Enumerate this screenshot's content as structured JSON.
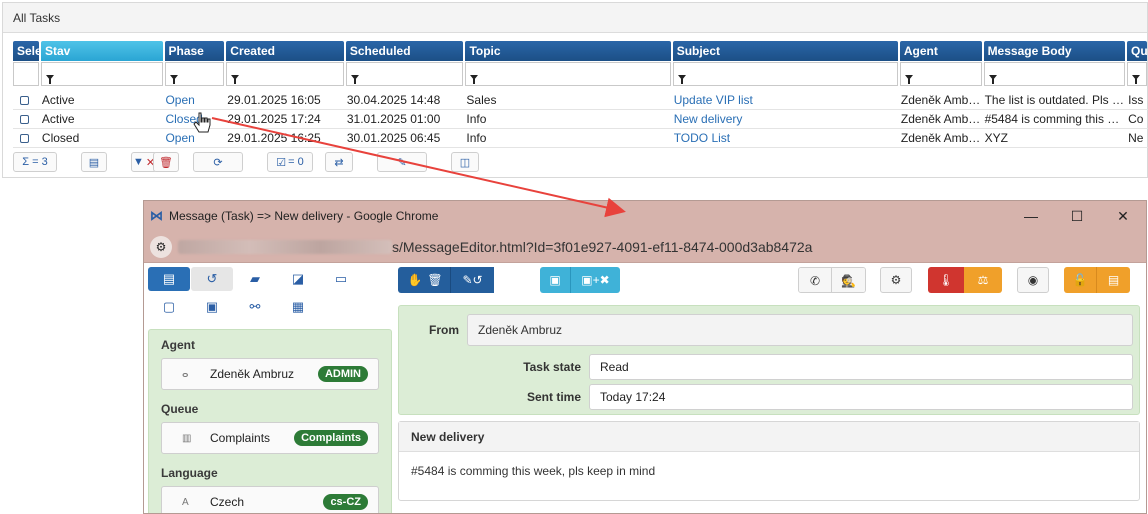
{
  "tasks": {
    "title": "All Tasks",
    "columns": [
      "Sele",
      "Stav",
      "Phase",
      "Created",
      "Scheduled",
      "Topic",
      "Subject",
      "Agent",
      "Message Body",
      "Qu"
    ],
    "rows": [
      {
        "stav": "Active",
        "phase": "Open",
        "created": "29.01.2025 16:05",
        "scheduled": "30.04.2025 14:48",
        "topic": "Sales",
        "subject": "Update VIP list",
        "agent": "Zdeněk Amb…",
        "body": "The list is outdated. Pls …",
        "queue": "Iss"
      },
      {
        "stav": "Active",
        "phase": "Closed",
        "created": "29.01.2025 17:24",
        "scheduled": "31.01.2025 01:00",
        "topic": "Info",
        "subject": "New delivery",
        "agent": "Zdeněk Amb…",
        "body": "#5484 is comming this …",
        "queue": "Co"
      },
      {
        "stav": "Closed",
        "phase": "Open",
        "created": "29.01.2025 16:25",
        "scheduled": "30.01.2025 06:45",
        "topic": "Info",
        "subject": "TODO List",
        "agent": "Zdeněk Amb…",
        "body": "XYZ",
        "queue": "Ne"
      }
    ],
    "footer": {
      "count_label": "Σ = 3",
      "selected_label": "= 0"
    }
  },
  "window": {
    "title": "Message (Task) => New delivery - Google Chrome",
    "url": "s/MessageEditor.html?Id=3f01e927-4091-ef11-8474-000d3ab8472a"
  },
  "sidebar": {
    "agent_label": "Agent",
    "agent_value": "Zdeněk Ambruz",
    "agent_badge": "ADMIN",
    "queue_label": "Queue",
    "queue_value": "Complaints",
    "queue_badge": "Complaints",
    "language_label": "Language",
    "language_value": "Czech",
    "language_badge": "cs-CZ"
  },
  "form": {
    "from_label": "From",
    "from_value": "Zdeněk Ambruz",
    "task_state_label": "Task state",
    "task_state_value": "Read",
    "sent_time_label": "Sent time",
    "sent_time_value": "Today 17:24"
  },
  "message": {
    "subject": "New delivery",
    "body": "#5484 is comming this week, pls keep in mind"
  },
  "colors": {
    "header_blue": "#1c4f86",
    "active_header": "#2aa5d4",
    "titlebar": "#d6b3ac",
    "panel_green": "#dcedd6",
    "badge_green": "#2d7b37",
    "arrow_red": "#e8423c"
  }
}
